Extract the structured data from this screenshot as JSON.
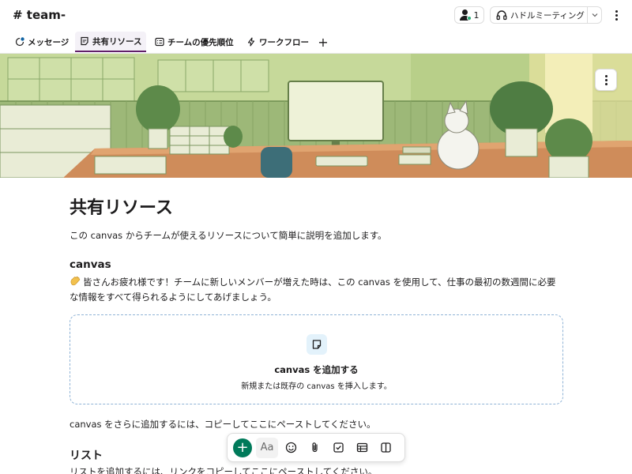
{
  "header": {
    "channel_name": "# team-",
    "member_count": "1",
    "huddle_label": "ハドルミーティング"
  },
  "tabs": [
    {
      "label": "メッセージ",
      "icon": "message-icon"
    },
    {
      "label": "共有リソース",
      "icon": "canvas-icon",
      "active": true
    },
    {
      "label": "チームの優先順位",
      "icon": "list-icon"
    },
    {
      "label": "ワークフロー",
      "icon": "bolt-icon"
    }
  ],
  "add_tab_label": "+",
  "document": {
    "title": "共有リソース",
    "intro": "この canvas からチームが使えるリソースについて簡単に説明を追加します。",
    "section_heading": "canvas",
    "section_body_line1": "皆さんお疲れ様です！チームに新しいメンバーが増えた時は、この canvas を使用して、仕事の最初の数週間に必要",
    "section_body_line2": "な情報をすべて得られるようにしてあげましょう。",
    "drop_title": "canvas を追加する",
    "drop_subtitle": "新規または既存の canvas を挿入します。",
    "paste_line": "canvas をさらに追加するには、コピーしてここにペーストしてください。",
    "list_heading": "リスト",
    "list_body": "リストを追加するには、リンクをコピーしてここにペーストしてください。"
  },
  "toolbar": {
    "add_label": "+",
    "format_label": "Aa",
    "icons": [
      "emoji-icon",
      "attachment-icon",
      "checkbox-icon",
      "table-icon",
      "layout-icon"
    ]
  },
  "colors": {
    "accent": "#611f69",
    "add_button": "#007a5a",
    "dashed_border": "#8fb3d6",
    "banner_green": "#b9cf8a"
  }
}
